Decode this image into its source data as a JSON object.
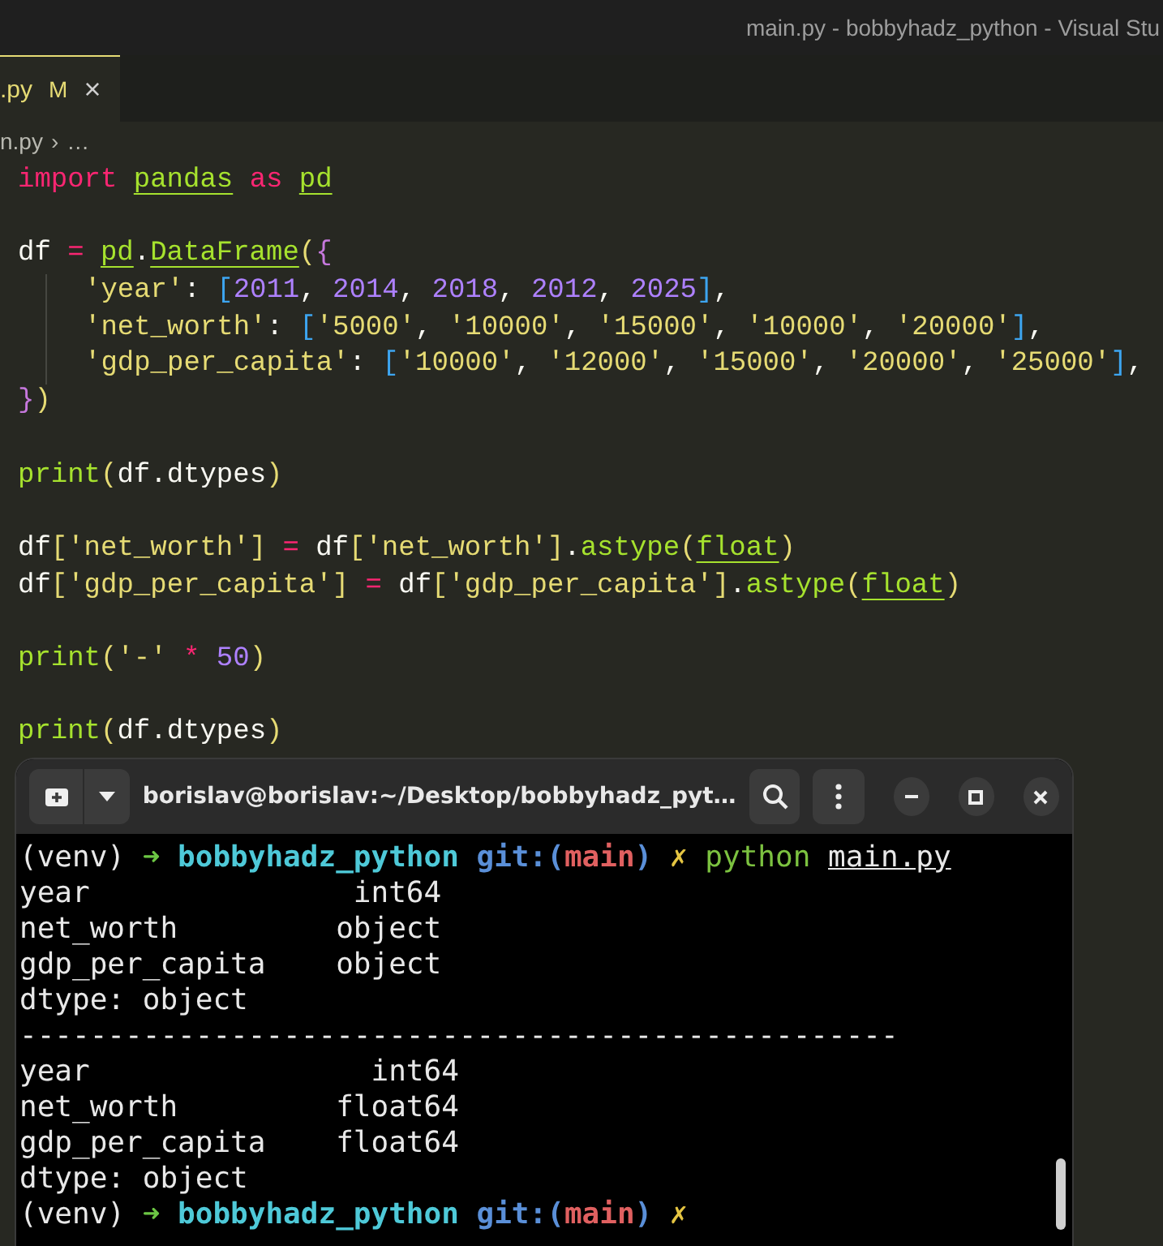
{
  "window": {
    "title": "main.py - bobbyhadz_python - Visual Stu"
  },
  "tab": {
    "label": ".py",
    "badge": "M",
    "close": "×",
    "selected": true
  },
  "breadcrumb": {
    "file": "n.py",
    "separator": "›",
    "rest": "…"
  },
  "code": {
    "lines": [
      {
        "kind": "code",
        "indented": false,
        "tokens": [
          {
            "kind": "kw",
            "text": "import"
          },
          {
            "kind": "mod",
            "text": "pandas",
            "gap": true
          },
          {
            "kind": "kw",
            "text": "as",
            "gap": true
          },
          {
            "kind": "mod",
            "text": "pd",
            "gap": true
          }
        ]
      },
      {
        "kind": "blank"
      },
      {
        "kind": "code",
        "indented": false,
        "tokens": [
          {
            "kind": "plain",
            "text": "df"
          },
          {
            "kind": "op",
            "text": "=",
            "gap": true
          },
          {
            "kind": "mod",
            "text": "pd",
            "gap": true
          },
          {
            "kind": "plain",
            "text": "."
          },
          {
            "kind": "mod",
            "text": "DataFrame"
          },
          {
            "kind": "br1",
            "text": "("
          },
          {
            "kind": "br2",
            "text": "{"
          }
        ]
      },
      {
        "kind": "code",
        "indented": true,
        "tokens": [
          {
            "kind": "str",
            "text": "'year'"
          },
          {
            "kind": "plain",
            "text": ": "
          },
          {
            "kind": "br3",
            "text": "["
          },
          {
            "kind": "num",
            "text": "2011"
          },
          {
            "kind": "plain",
            "text": ", "
          },
          {
            "kind": "num",
            "text": "2014"
          },
          {
            "kind": "plain",
            "text": ", "
          },
          {
            "kind": "num",
            "text": "2018"
          },
          {
            "kind": "plain",
            "text": ", "
          },
          {
            "kind": "num",
            "text": "2012"
          },
          {
            "kind": "plain",
            "text": ", "
          },
          {
            "kind": "num",
            "text": "2025"
          },
          {
            "kind": "br3",
            "text": "]"
          },
          {
            "kind": "plain",
            "text": ","
          }
        ]
      },
      {
        "kind": "code",
        "indented": true,
        "tokens": [
          {
            "kind": "str",
            "text": "'net_worth'"
          },
          {
            "kind": "plain",
            "text": ": "
          },
          {
            "kind": "br3",
            "text": "["
          },
          {
            "kind": "str",
            "text": "'5000'"
          },
          {
            "kind": "plain",
            "text": ", "
          },
          {
            "kind": "str",
            "text": "'10000'"
          },
          {
            "kind": "plain",
            "text": ", "
          },
          {
            "kind": "str",
            "text": "'15000'"
          },
          {
            "kind": "plain",
            "text": ", "
          },
          {
            "kind": "str",
            "text": "'10000'"
          },
          {
            "kind": "plain",
            "text": ", "
          },
          {
            "kind": "str",
            "text": "'20000'"
          },
          {
            "kind": "br3",
            "text": "]"
          },
          {
            "kind": "plain",
            "text": ","
          }
        ]
      },
      {
        "kind": "code",
        "indented": true,
        "tokens": [
          {
            "kind": "str",
            "text": "'gdp_per_capita'"
          },
          {
            "kind": "plain",
            "text": ": "
          },
          {
            "kind": "br3",
            "text": "["
          },
          {
            "kind": "str",
            "text": "'10000'"
          },
          {
            "kind": "plain",
            "text": ", "
          },
          {
            "kind": "str",
            "text": "'12000'"
          },
          {
            "kind": "plain",
            "text": ", "
          },
          {
            "kind": "str",
            "text": "'15000'"
          },
          {
            "kind": "plain",
            "text": ", "
          },
          {
            "kind": "str",
            "text": "'20000'"
          },
          {
            "kind": "plain",
            "text": ", "
          },
          {
            "kind": "str",
            "text": "'25000'"
          },
          {
            "kind": "br3",
            "text": "]"
          },
          {
            "kind": "plain",
            "text": ","
          }
        ]
      },
      {
        "kind": "code",
        "indented": false,
        "tokens": [
          {
            "kind": "br2",
            "text": "}"
          },
          {
            "kind": "br1",
            "text": ")"
          }
        ]
      },
      {
        "kind": "blank"
      },
      {
        "kind": "code",
        "indented": false,
        "tokens": [
          {
            "kind": "fn",
            "text": "print"
          },
          {
            "kind": "br1",
            "text": "("
          },
          {
            "kind": "plain",
            "text": "df.dtypes"
          },
          {
            "kind": "br1",
            "text": ")"
          }
        ]
      },
      {
        "kind": "blank"
      },
      {
        "kind": "code",
        "indented": false,
        "tokens": [
          {
            "kind": "plain",
            "text": "df"
          },
          {
            "kind": "br1",
            "text": "["
          },
          {
            "kind": "str",
            "text": "'net_worth'"
          },
          {
            "kind": "br1",
            "text": "]"
          },
          {
            "kind": "op",
            "text": "=",
            "gap": true
          },
          {
            "kind": "plain",
            "text": "df",
            "gap": true
          },
          {
            "kind": "br1",
            "text": "["
          },
          {
            "kind": "str",
            "text": "'net_worth'"
          },
          {
            "kind": "br1",
            "text": "]"
          },
          {
            "kind": "plain",
            "text": "."
          },
          {
            "kind": "fn",
            "text": "astype"
          },
          {
            "kind": "br1",
            "text": "("
          },
          {
            "kind": "mod",
            "text": "float"
          },
          {
            "kind": "br1",
            "text": ")"
          }
        ]
      },
      {
        "kind": "code",
        "indented": false,
        "tokens": [
          {
            "kind": "plain",
            "text": "df"
          },
          {
            "kind": "br1",
            "text": "["
          },
          {
            "kind": "str",
            "text": "'gdp_per_capita'"
          },
          {
            "kind": "br1",
            "text": "]"
          },
          {
            "kind": "op",
            "text": "=",
            "gap": true
          },
          {
            "kind": "plain",
            "text": "df",
            "gap": true
          },
          {
            "kind": "br1",
            "text": "["
          },
          {
            "kind": "str",
            "text": "'gdp_per_capita'"
          },
          {
            "kind": "br1",
            "text": "]"
          },
          {
            "kind": "plain",
            "text": "."
          },
          {
            "kind": "fn",
            "text": "astype"
          },
          {
            "kind": "br1",
            "text": "("
          },
          {
            "kind": "mod",
            "text": "float"
          },
          {
            "kind": "br1",
            "text": ")"
          }
        ]
      },
      {
        "kind": "blank"
      },
      {
        "kind": "code",
        "indented": false,
        "tokens": [
          {
            "kind": "fn",
            "text": "print"
          },
          {
            "kind": "br1",
            "text": "("
          },
          {
            "kind": "str",
            "text": "'-'"
          },
          {
            "kind": "op",
            "text": "*",
            "gap": true
          },
          {
            "kind": "num",
            "text": "50",
            "gap": true
          },
          {
            "kind": "br1",
            "text": ")"
          }
        ]
      },
      {
        "kind": "blank"
      },
      {
        "kind": "code",
        "indented": false,
        "tokens": [
          {
            "kind": "fn",
            "text": "print"
          },
          {
            "kind": "br1",
            "text": "("
          },
          {
            "kind": "plain",
            "text": "df.dtypes"
          },
          {
            "kind": "br1",
            "text": ")"
          }
        ]
      }
    ]
  },
  "terminal": {
    "title": "borislav@borislav:~/Desktop/bobbyhadz_pyt…",
    "lines": [
      [
        {
          "kind": "plain",
          "text": "(venv)"
        },
        {
          "kind": "arrow",
          "text": "➜",
          "gap": true
        },
        {
          "kind": "dir",
          "text": "bobbyhadz_python",
          "gap": true
        },
        {
          "kind": "git",
          "text": "git:(",
          "gap": true
        },
        {
          "kind": "branch",
          "text": "main"
        },
        {
          "kind": "git",
          "text": ")"
        },
        {
          "kind": "x",
          "text": "✗",
          "gap": true
        },
        {
          "kind": "cmd",
          "text": "python",
          "gap": true
        },
        {
          "kind": "arg",
          "text": "main.py",
          "gap": true
        }
      ],
      [
        {
          "kind": "plain",
          "text": "year               int64"
        }
      ],
      [
        {
          "kind": "plain",
          "text": "net_worth         object"
        }
      ],
      [
        {
          "kind": "plain",
          "text": "gdp_per_capita    object"
        }
      ],
      [
        {
          "kind": "plain",
          "text": "dtype: object"
        }
      ],
      [
        {
          "kind": "plain",
          "text": "--------------------------------------------------"
        }
      ],
      [
        {
          "kind": "plain",
          "text": "year                int64"
        }
      ],
      [
        {
          "kind": "plain",
          "text": "net_worth         float64"
        }
      ],
      [
        {
          "kind": "plain",
          "text": "gdp_per_capita    float64"
        }
      ],
      [
        {
          "kind": "plain",
          "text": "dtype: object"
        }
      ],
      [
        {
          "kind": "plain",
          "text": "(venv)"
        },
        {
          "kind": "arrow",
          "text": "➜",
          "gap": true
        },
        {
          "kind": "dir",
          "text": "bobbyhadz_python",
          "gap": true
        },
        {
          "kind": "git",
          "text": "git:(",
          "gap": true
        },
        {
          "kind": "branch",
          "text": "main"
        },
        {
          "kind": "git",
          "text": ")"
        },
        {
          "kind": "x",
          "text": "✗",
          "gap": true
        }
      ]
    ]
  }
}
